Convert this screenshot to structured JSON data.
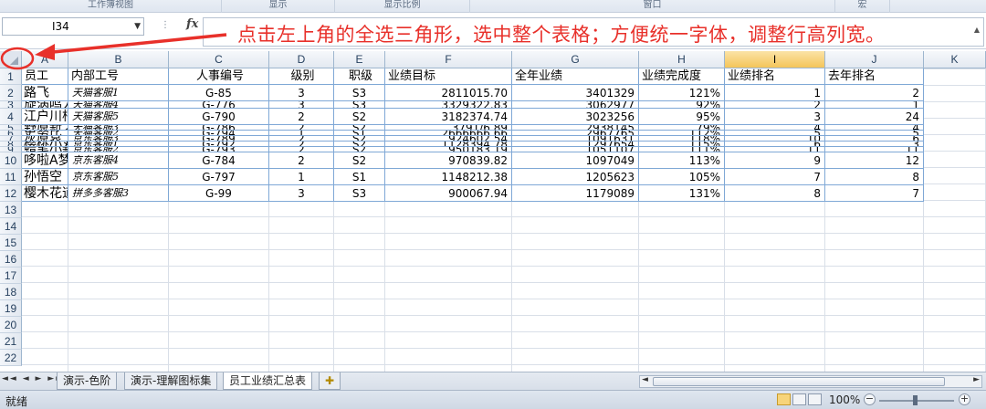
{
  "ribbon": {
    "groups": [
      "工作簿视图",
      "显示",
      "显示比例",
      "窗口",
      "宏"
    ]
  },
  "formula_bar": {
    "name_box": "I34",
    "fx_label": "fx",
    "formula": ""
  },
  "annotation": {
    "text": "点击左上角的全选三角形，选中整个表格；方便统一字体，调整行高列宽。",
    "color": "#e8302a"
  },
  "columns": [
    "A",
    "B",
    "C",
    "D",
    "E",
    "F",
    "G",
    "H",
    "I",
    "J",
    "K"
  ],
  "selected_column": "I",
  "row_numbers": [
    "1",
    "2",
    "3",
    "4",
    "5",
    "6",
    "7",
    "8",
    "9",
    "10",
    "11",
    "12",
    "13",
    "14",
    "15",
    "16",
    "17",
    "18",
    "19",
    "20",
    "21",
    "22"
  ],
  "header_row": [
    "员工",
    "内部工号",
    "人事编号",
    "级别",
    "职级",
    "业绩目标",
    "全年业绩",
    "业绩完成度",
    "业绩排名",
    "去年排名"
  ],
  "rows": [
    [
      "路飞",
      "天猫客服1",
      "G-85",
      "3",
      "S3",
      "2811015.70",
      "3401329",
      "121%",
      "1",
      "2"
    ],
    [
      "旋涡鸣人",
      "天猫客服4",
      "G-776",
      "3",
      "S3",
      "3329322.83",
      "3062977",
      "92%",
      "2",
      "1"
    ],
    [
      "江户川柯南",
      "天猫客服5",
      "G-790",
      "2",
      "S2",
      "3182374.74",
      "3023256",
      "95%",
      "3",
      "24"
    ],
    [
      "野原新之助",
      "天猫客服3",
      "G-786",
      "2",
      "S2",
      "3791/6.89",
      "2938145",
      "79%",
      "4",
      "4"
    ],
    [
      "史努比",
      "天猫客服2",
      "G-794",
      "1",
      "S1",
      "2666666.66",
      "2967765",
      "112%",
      "5",
      "5"
    ],
    [
      "灰原哀",
      "京东客服3",
      "G-789",
      "2",
      "S2",
      "924602.54",
      "1091631",
      "118%",
      "10",
      "6"
    ],
    [
      "樱桃小丸子",
      "京东客服1",
      "G-792",
      "2",
      "S2",
      "1128394.78",
      "1297654",
      "115%",
      "6",
      "3"
    ],
    [
      "蜡笔小新",
      "京东客服2",
      "G-793",
      "2",
      "S2",
      "950183.19",
      "1051107",
      "111%",
      "11",
      "11"
    ],
    [
      "哆啦A梦",
      "京东客服4",
      "G-784",
      "2",
      "S2",
      "970839.82",
      "1097049",
      "113%",
      "9",
      "12"
    ],
    [
      "孙悟空",
      "京东客服5",
      "G-797",
      "1",
      "S1",
      "1148212.38",
      "1205623",
      "105%",
      "7",
      "8"
    ],
    [
      "樱木花道",
      "拼多多客服3",
      "G-99",
      "3",
      "S3",
      "900067.94",
      "1179089",
      "131%",
      "8",
      "7"
    ]
  ],
  "sheet_tabs": [
    "演示-色阶",
    "演示-理解图标集",
    "员工业绩汇总表"
  ],
  "active_tab": "员工业绩汇总表",
  "tab_nav_label": "◄◄ ◄ ► ►►",
  "status": {
    "ready": "就绪",
    "zoom": "100%",
    "zoom_minus": "−",
    "zoom_plus": "+"
  }
}
